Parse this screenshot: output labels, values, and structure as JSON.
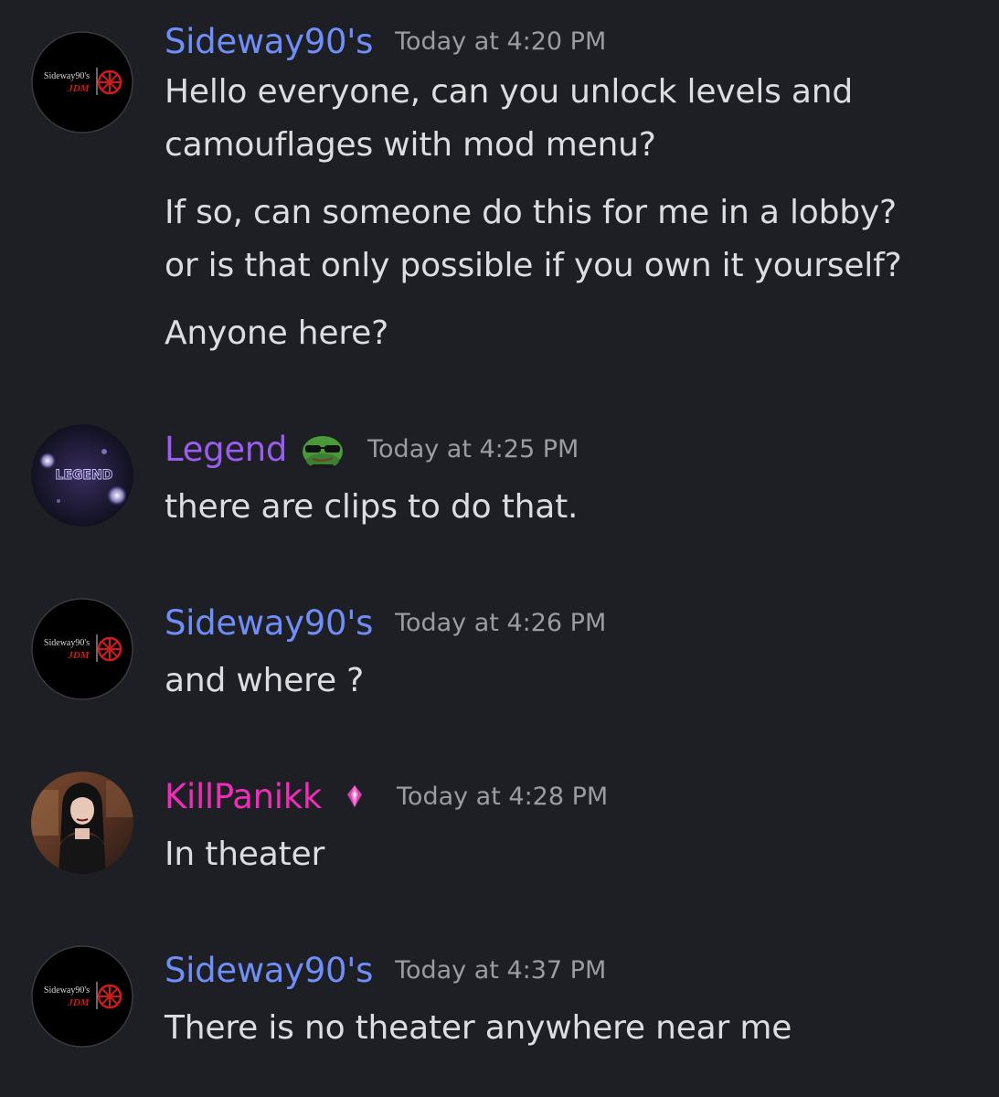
{
  "colors": {
    "background": "#1e1f24",
    "sideway_name": "#6f8ef7",
    "legend_name": "#9b5cf0",
    "killpanikk_name": "#ef2db9",
    "timestamp": "#9a9ca4",
    "message_text": "#dbdee1"
  },
  "messages": [
    {
      "author": "Sideway90's",
      "timestamp": "Today at 4:20 PM",
      "avatar_text": {
        "line1": "Sideway90's",
        "line2": "JDM"
      },
      "lines": [
        "Hello everyone, can you unlock levels and",
        "camouflages with mod menu?",
        "If so, can someone do this for me in a lobby?",
        "or is that only possible if you own it yourself?",
        "Anyone here?"
      ]
    },
    {
      "author": "Legend",
      "timestamp": "Today at 4:25 PM",
      "avatar_text": "LEGEND",
      "badge": "pepe-sunglasses-icon",
      "lines": [
        "there are clips to do that."
      ]
    },
    {
      "author": "Sideway90's",
      "timestamp": "Today at 4:26 PM",
      "avatar_text": {
        "line1": "Sideway90's",
        "line2": "JDM"
      },
      "lines": [
        "and where ?"
      ]
    },
    {
      "author": "KillPanikk",
      "timestamp": "Today at 4:28 PM",
      "badge": "nitro-gem-icon",
      "lines": [
        "In theater"
      ]
    },
    {
      "author": "Sideway90's",
      "timestamp": "Today at 4:37 PM",
      "avatar_text": {
        "line1": "Sideway90's",
        "line2": "JDM"
      },
      "lines": [
        "There is no theater anywhere near me"
      ]
    }
  ]
}
